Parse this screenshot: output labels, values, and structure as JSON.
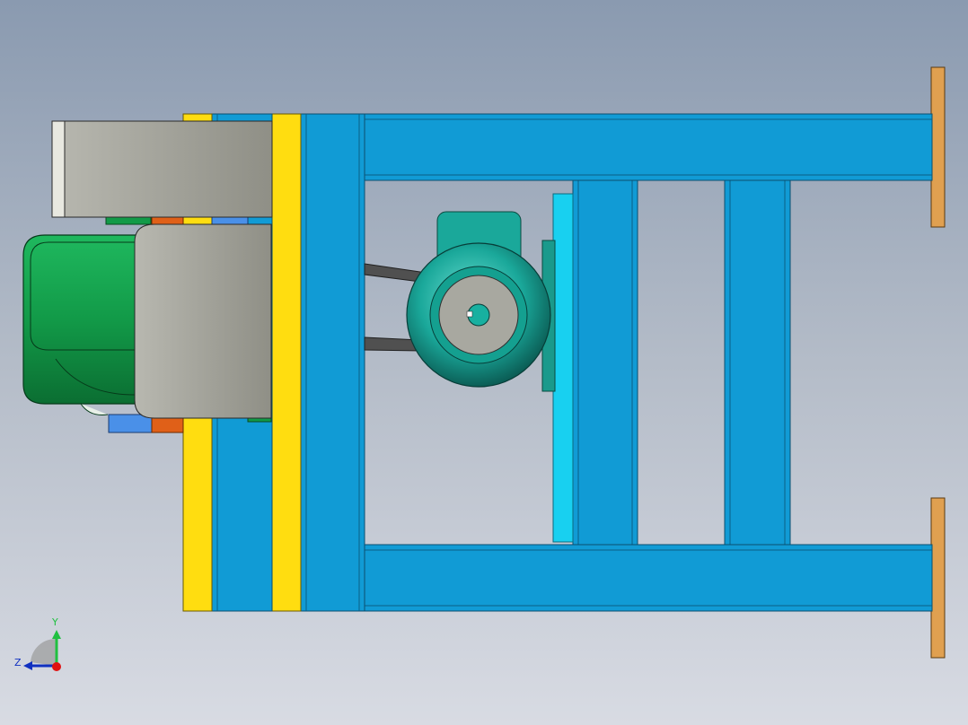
{
  "triad": {
    "y_label": "Y",
    "z_label": "Z"
  },
  "colors": {
    "background_top": "#8a9ab0",
    "background_bottom": "#d8dbe3",
    "frame_blue": "#119bd5",
    "frame_edge": "#0a5f85",
    "yellow_plate": "#ffdd10",
    "orange_foot": "#e0a050",
    "cyan_plate": "#18d0f0",
    "motor_green": "#129a48",
    "pulley_teal": "#1aa89a",
    "housing_gray": "#9a9a90",
    "belt": "#505050"
  }
}
